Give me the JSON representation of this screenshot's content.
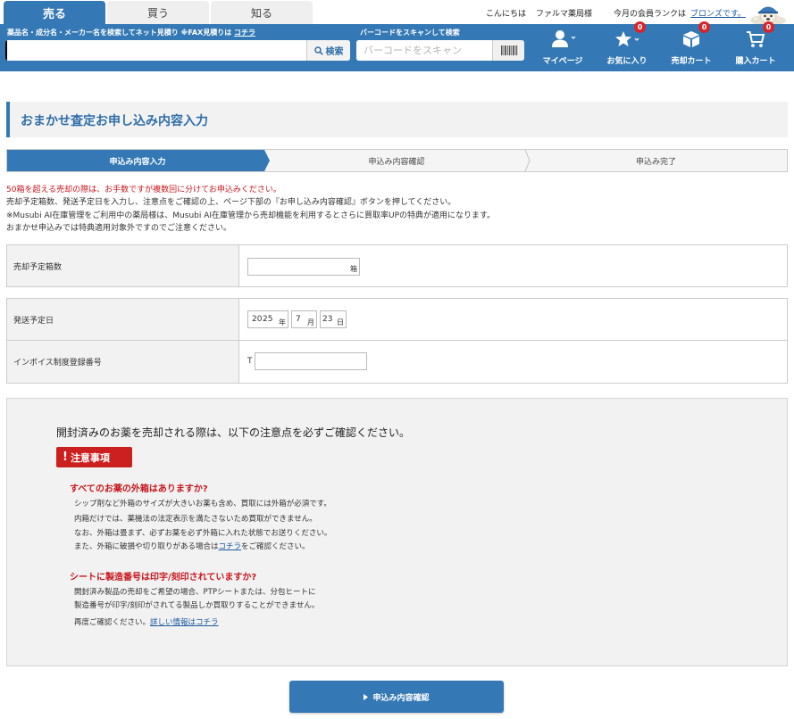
{
  "header": {
    "tabs": [
      {
        "label": "売る",
        "active": true
      },
      {
        "label": "買う",
        "active": false
      },
      {
        "label": "知る",
        "active": false
      }
    ],
    "greeting": "こんにちは",
    "user_name": "ファルマ薬局様",
    "rank_label": "今月の会員ランクは",
    "rank_value": "ブロンズです。",
    "search": {
      "label": "薬品名・成分名・メーカー名を検索してネット見積り ※FAX見積りは",
      "label_link": "コチラ",
      "placeholder": "",
      "button": "検索"
    },
    "barcode": {
      "label": "バーコードをスキャンして検索",
      "placeholder": "バーコードをスキャン"
    },
    "nav": [
      {
        "label": "マイページ",
        "icon": "user-icon"
      },
      {
        "label": "お気に入り",
        "icon": "star-icon",
        "badge": "0"
      },
      {
        "label": "売却カート",
        "icon": "box-icon",
        "badge": "0"
      },
      {
        "label": "購入カート",
        "icon": "cart-icon",
        "badge": "0"
      }
    ]
  },
  "page": {
    "title": "おまかせ査定お申し込み内容入力",
    "steps": [
      "申込み内容入力",
      "申込み内容確認",
      "申込み完了"
    ],
    "notes": {
      "warning": "50箱を超える売却の際は、お手数ですが複数回に分けてお申込みください。",
      "line2": "売却予定箱数、発送予定日を入力し、注意点をご確認の上、ページ下部の『お申し込み内容確認』ボタンを押してください。",
      "line3": "※Musubi AI在庫管理をご利用中の薬局様は、Musubi AI在庫管理から売却機能を利用するとさらに買取率UPの特典が適用になります。",
      "line4": "おまかせ申込みでは特典適用対象外ですのでご注意ください。"
    },
    "form": {
      "boxes_label": "売却予定箱数",
      "boxes_value": "",
      "boxes_unit": "箱",
      "ship_label": "発送予定日",
      "year_prefix": "20",
      "year_value": "25",
      "year_unit": "年",
      "month_value": "7",
      "month_unit": "月",
      "day_value": "23",
      "day_unit": "日",
      "invoice_label": "インボイス制度登録番号",
      "invoice_prefix": "T",
      "invoice_value": ""
    },
    "caution": {
      "lead": "開封済みのお薬を売却される際は、以下の注意点を必ずご確認ください。",
      "chip": "注意事項",
      "q1": "すべてのお薬の外箱はありますか?",
      "a1": [
        "シップ剤など外箱のサイズが大きいお薬も含め、買取には外箱が必須です。",
        "内箱だけでは、薬機法の法定表示を満たさないため買取ができません。",
        "なお、外箱は畳まず、必ずお薬を必ず外箱に入れた状態でお送りください。"
      ],
      "a1_last_pre": "また、外箱に破損や切り取りがある場合は",
      "a1_last_link": "コチラ",
      "a1_last_post": "をご確認ください。",
      "q2": "シートに製造番号は印字/刻印されていますか?",
      "a2": [
        "開封済み製品の売却をご希望の場合、PTPシートまたは、分包ヒートに",
        "製造番号が印字/刻印がされてる製品しか買取りすることができません。"
      ],
      "a2_last_pre": "再度ご確認ください。",
      "a2_last_link": "詳しい情報はコチラ"
    },
    "submit": "申込み内容確認"
  }
}
